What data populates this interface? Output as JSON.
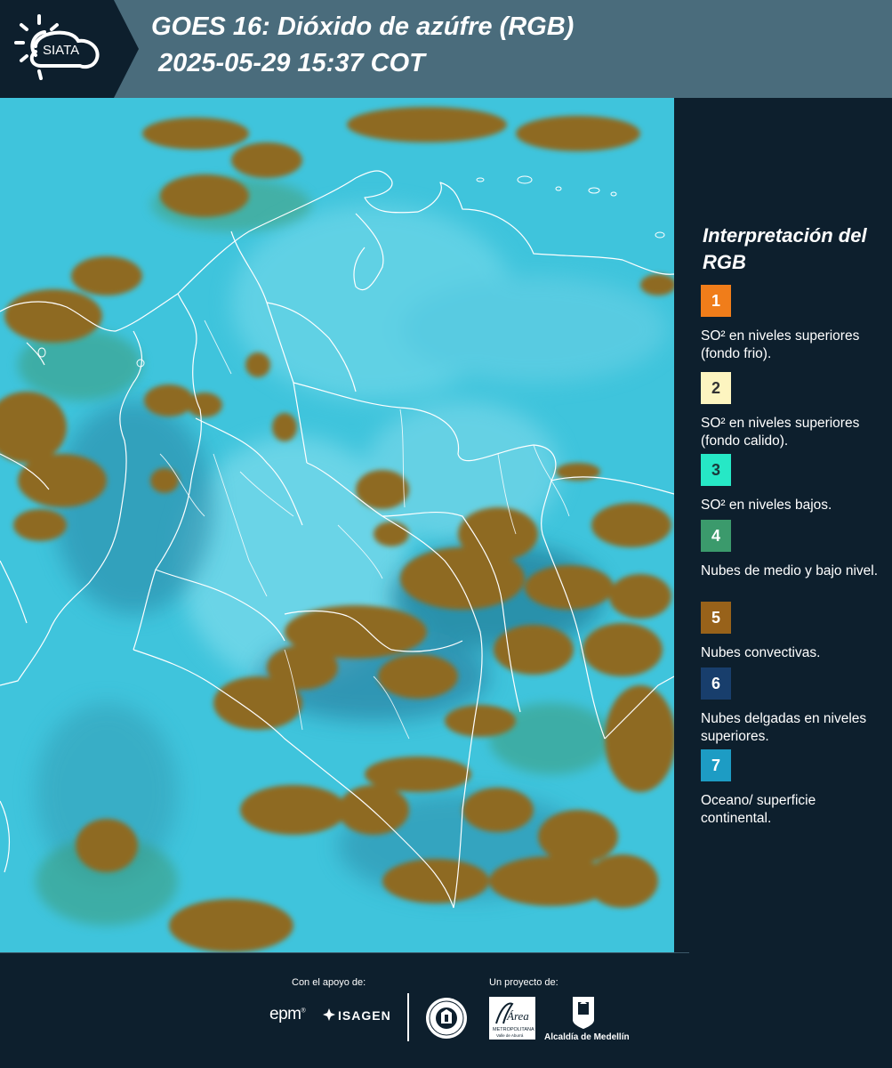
{
  "header": {
    "brand": "SIATA",
    "title_line1": "GOES 16: Dióxido de azúfre (RGB)",
    "title_line2": "2025-05-29 15:37 COT"
  },
  "legend": {
    "title": "Interpretación del RGB",
    "items": [
      {
        "number": "1",
        "label": "SO² en niveles superiores (fondo frio).",
        "color": "#f07d1a",
        "text_color": "#ffffff"
      },
      {
        "number": "2",
        "label": "SO² en niveles superiores (fondo calido).",
        "color": "#fdf5c0",
        "text_color": "#333333"
      },
      {
        "number": "3",
        "label": "SO² en niveles bajos.",
        "color": "#26e8c6",
        "text_color": "#1a3a3a"
      },
      {
        "number": "4",
        "label": "Nubes de medio y bajo nivel.",
        "color": "#3b9a6c",
        "text_color": "#ffffff"
      },
      {
        "number": "5",
        "label": "Nubes convectivas.",
        "color": "#98621a",
        "text_color": "#ffffff"
      },
      {
        "number": "6",
        "label": "Nubes delgadas en niveles superiores.",
        "color": "#183e6c",
        "text_color": "#ffffff"
      },
      {
        "number": "7",
        "label": "Oceano/ superficie continental.",
        "color": "#1d9cc4",
        "text_color": "#ffffff"
      }
    ]
  },
  "footer": {
    "support_label": "Con el apoyo de:",
    "project_label": "Un proyecto de:",
    "epm": "epm",
    "isagen": "ISAGEN",
    "metro_name": "Área",
    "metro_sub": "METROPOLITANA",
    "alcaldia": "Alcaldía de Medellín"
  },
  "map": {
    "ocean_color": "#3fc4dc",
    "cloud_color": "#8e6a24",
    "border_color": "#ffffff"
  }
}
